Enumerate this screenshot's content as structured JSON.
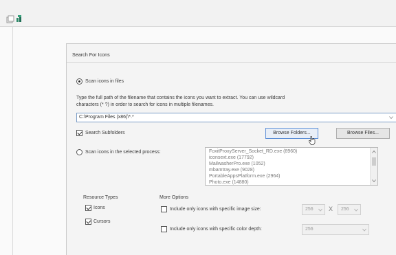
{
  "dialog": {
    "title": "Search For Icons",
    "scan_files_label": "Scan icons in files",
    "instructions_line1": "Type the full path of the filename that contains the icons you want to extract. You can use wildcard",
    "instructions_line2": "characters (* ?) in order to search for icons in multiple filenames.",
    "path_value": "C:\\Program Files (x86)\\*.*",
    "search_subfolders_label": "Search Subfolders",
    "browse_folders_label": "Browse Folders...",
    "browse_files_label": "Browse Files...",
    "scan_process_label": "Scan icons in the selected process:",
    "processes": [
      "FoxitProxyServer_Socket_RD.exe  (8960)",
      "iconsext.exe  (17792)",
      "MailwasherPro.exe  (1052)",
      "mbamtray.exe  (9028)",
      "PortableAppsPlatform.exe  (2964)",
      "Photo.exe  (14880)"
    ],
    "resource_types_title": "Resource Types",
    "icons_label": "Icons",
    "cursors_label": "Cursors",
    "more_options_title": "More Options",
    "specific_size_label": "Include only icons with specific image size:",
    "size_width": "256",
    "size_x": "X",
    "size_height": "256",
    "specific_depth_label": "Include only icons with specific color depth:",
    "depth_value": "256"
  },
  "state": {
    "scan_mode": "files",
    "search_subfolders": true,
    "icons_checked": true,
    "cursors_checked": true,
    "specific_size": false,
    "specific_depth": false
  }
}
